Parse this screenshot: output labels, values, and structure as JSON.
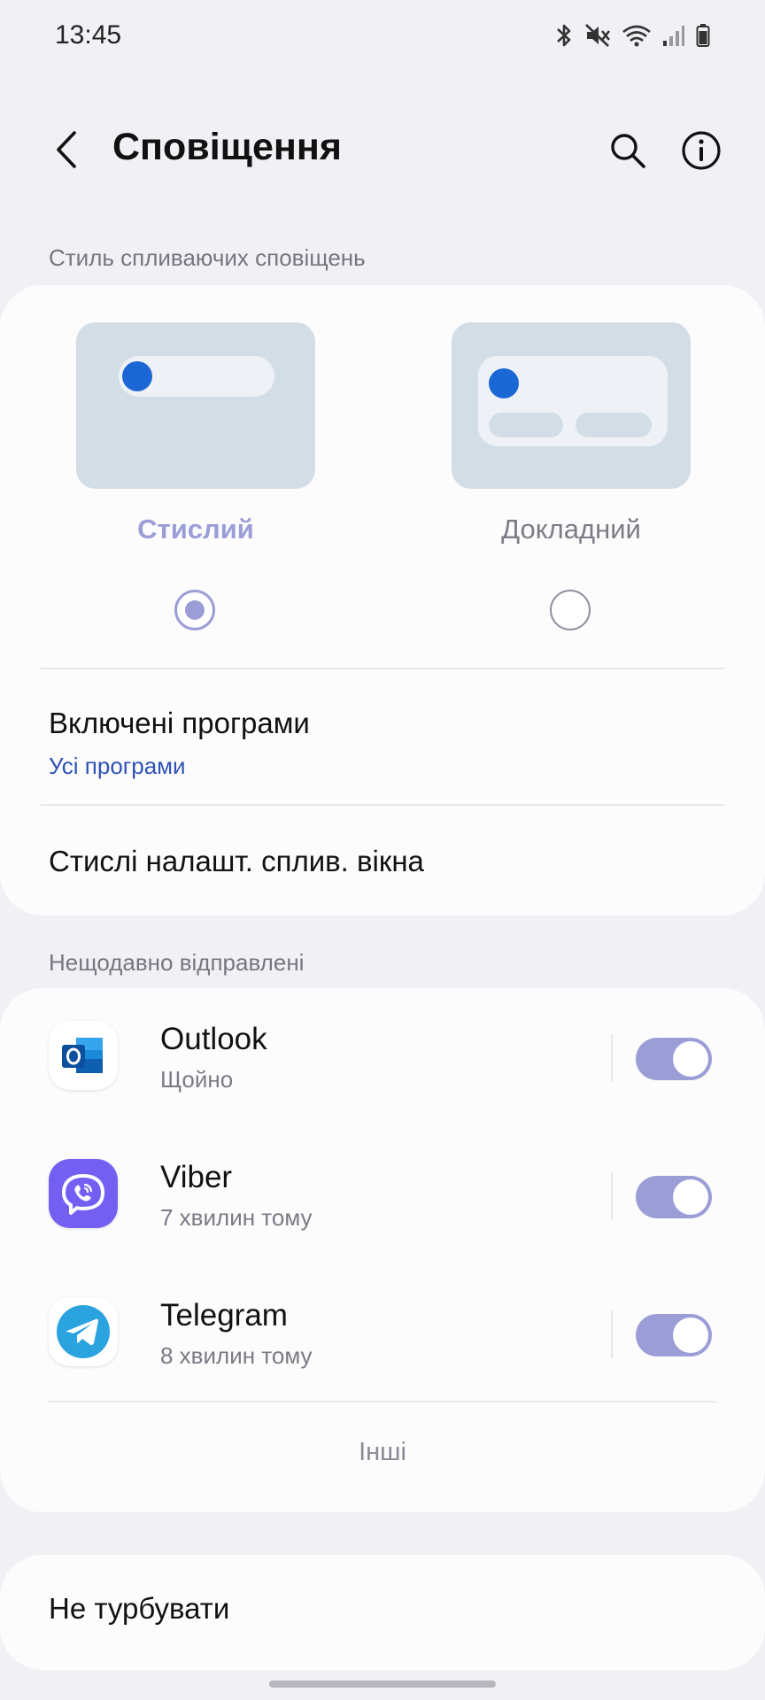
{
  "status_bar": {
    "time": "13:45"
  },
  "header": {
    "title": "Сповіщення"
  },
  "popup_style": {
    "section_title": "Стиль спливаючих сповіщень",
    "options": [
      {
        "label": "Стислий",
        "selected": true
      },
      {
        "label": "Докладний",
        "selected": false
      }
    ],
    "included_apps_title": "Включені програми",
    "included_apps_value": "Усі програми",
    "brief_settings_title": "Стислі налашт. сплив. вікна"
  },
  "recent": {
    "section_title": "Нещодавно відправлені",
    "apps": [
      {
        "name": "Outlook",
        "time": "Щойно",
        "enabled": true,
        "icon": "outlook-icon"
      },
      {
        "name": "Viber",
        "time": "7 хвилин тому",
        "enabled": true,
        "icon": "viber-icon"
      },
      {
        "name": "Telegram",
        "time": "8 хвилин тому",
        "enabled": true,
        "icon": "telegram-icon"
      }
    ],
    "others_label": "Інші"
  },
  "dnd": {
    "title": "Не турбувати"
  },
  "colors": {
    "accent": "#9b9ed6",
    "link": "#2f52b5",
    "preview_dot": "#1c67d6"
  }
}
